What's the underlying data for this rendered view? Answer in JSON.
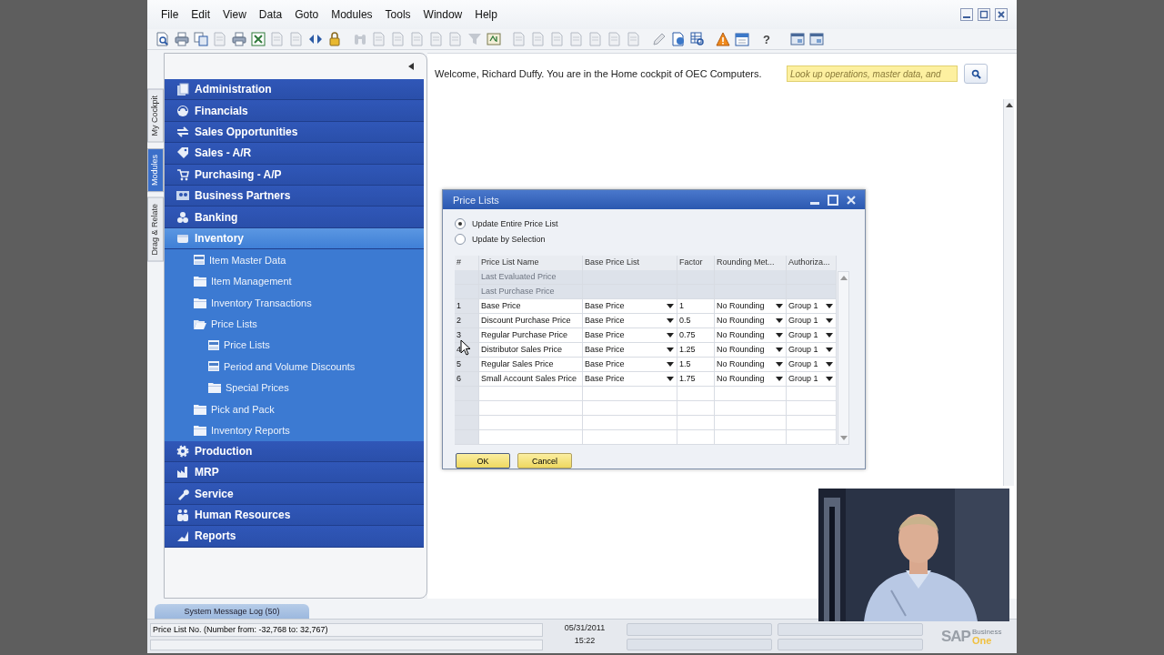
{
  "menu": [
    {
      "label": "File"
    },
    {
      "label": "Edit"
    },
    {
      "label": "View"
    },
    {
      "label": "Data"
    },
    {
      "label": "Goto"
    },
    {
      "label": "Modules"
    },
    {
      "label": "Tools"
    },
    {
      "label": "Window"
    },
    {
      "label": "Help"
    }
  ],
  "toolbar": {
    "help": "?"
  },
  "sidebar": {
    "tabs": [
      {
        "label": "My Cockpit",
        "selected": false
      },
      {
        "label": "Modules",
        "selected": true
      },
      {
        "label": "Drag & Relate",
        "selected": false
      }
    ],
    "modules": [
      {
        "label": "Administration",
        "expanded": false
      },
      {
        "label": "Financials",
        "expanded": false
      },
      {
        "label": "Sales Opportunities",
        "expanded": false
      },
      {
        "label": "Sales - A/R",
        "expanded": false
      },
      {
        "label": "Purchasing - A/P",
        "expanded": false
      },
      {
        "label": "Business Partners",
        "expanded": false
      },
      {
        "label": "Banking",
        "expanded": false
      },
      {
        "label": "Inventory",
        "expanded": true,
        "children": [
          {
            "label": "Item Master Data",
            "kind": "form"
          },
          {
            "label": "Item Management",
            "kind": "folder",
            "expanded": false
          },
          {
            "label": "Inventory Transactions",
            "kind": "folder",
            "expanded": false
          },
          {
            "label": "Price Lists",
            "kind": "folder",
            "expanded": true,
            "children": [
              {
                "label": "Price Lists",
                "kind": "form"
              },
              {
                "label": "Period and Volume Discounts",
                "kind": "form"
              },
              {
                "label": "Special Prices",
                "kind": "folder",
                "expanded": false
              }
            ]
          },
          {
            "label": "Pick and Pack",
            "kind": "folder",
            "expanded": false
          },
          {
            "label": "Inventory Reports",
            "kind": "folder",
            "expanded": false
          }
        ]
      },
      {
        "label": "Production",
        "expanded": false
      },
      {
        "label": "MRP",
        "expanded": false
      },
      {
        "label": "Service",
        "expanded": false
      },
      {
        "label": "Human Resources",
        "expanded": false
      },
      {
        "label": "Reports",
        "expanded": false
      }
    ]
  },
  "welcome": "Welcome, Richard Duffy. You are in the Home cockpit of OEC Computers.",
  "search": {
    "placeholder": "Look up operations, master data, and"
  },
  "dialog": {
    "title": "Price Lists",
    "options": [
      {
        "label": "Update Entire Price List",
        "selected": true
      },
      {
        "label": "Update by Selection",
        "selected": false
      }
    ],
    "columns": [
      "#",
      "Price List Name",
      "Base Price List",
      "Factor",
      "Rounding Met...",
      "Authoriza..."
    ],
    "fixed_rows": [
      {
        "name": "Last Evaluated Price"
      },
      {
        "name": "Last Purchase Price"
      }
    ],
    "rows": [
      {
        "number": "1",
        "name": "Base Price",
        "base": "Base Price",
        "factor": "1",
        "rounding": "No Rounding",
        "authorization": "Group 1"
      },
      {
        "number": "2",
        "name": "Discount Purchase Price",
        "base": "Base Price",
        "factor": "0.5",
        "rounding": "No Rounding",
        "authorization": "Group 1"
      },
      {
        "number": "3",
        "name": "Regular Purchase Price",
        "base": "Base Price",
        "factor": "0.75",
        "rounding": "No Rounding",
        "authorization": "Group 1"
      },
      {
        "number": "4",
        "name": "Distributor Sales Price",
        "base": "Base Price",
        "factor": "1.25",
        "rounding": "No Rounding",
        "authorization": "Group 1"
      },
      {
        "number": "5",
        "name": "Regular Sales Price",
        "base": "Base Price",
        "factor": "1.5",
        "rounding": "No Rounding",
        "authorization": "Group 1"
      },
      {
        "number": "6",
        "name": "Small Account Sales Price",
        "base": "Base Price",
        "factor": "1.75",
        "rounding": "No Rounding",
        "authorization": "Group 1"
      }
    ],
    "buttons": [
      "OK",
      "Cancel"
    ]
  },
  "message_log": "System Message Log (50)",
  "status_bar": {
    "message": "Price List No. (Number from: -32,768 to: 32,767)",
    "date": "05/31/2011",
    "time": "15:22"
  },
  "logo": {
    "mark": "SAP",
    "line_1": "Business",
    "line_2": "One"
  }
}
